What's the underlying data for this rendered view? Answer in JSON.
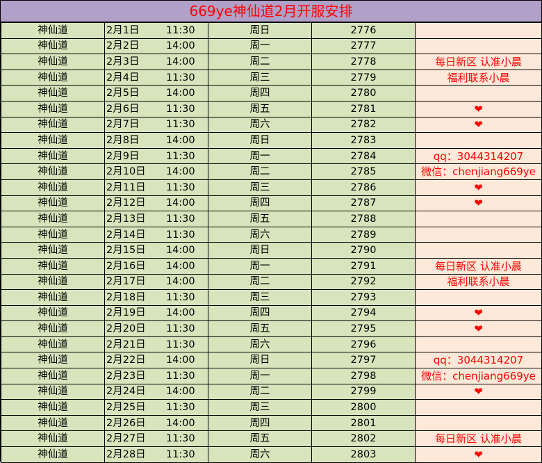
{
  "title": "669ye神仙道2月开服安排",
  "colors": {
    "header_bg": "#b1a0c7",
    "title_text": "#ff0000",
    "data_cell_bg": "#d8e4bc",
    "note_cell_bg": "#fde9d9",
    "note_text": "#ff0000"
  },
  "rows": [
    {
      "game": "神仙道",
      "date": "2月1日",
      "time": "11:30",
      "weekday": "周日",
      "server": "2776",
      "note": ""
    },
    {
      "game": "神仙道",
      "date": "2月2日",
      "time": "14:00",
      "weekday": "周一",
      "server": "2777",
      "note": ""
    },
    {
      "game": "神仙道",
      "date": "2月3日",
      "time": "14:00",
      "weekday": "周二",
      "server": "2778",
      "note": "每日新区 认准小晨"
    },
    {
      "game": "神仙道",
      "date": "2月4日",
      "time": "11:30",
      "weekday": "周三",
      "server": "2779",
      "note": "福利联系小晨"
    },
    {
      "game": "神仙道",
      "date": "2月5日",
      "time": "14:00",
      "weekday": "周四",
      "server": "2780",
      "note": ""
    },
    {
      "game": "神仙道",
      "date": "2月6日",
      "time": "11:30",
      "weekday": "周五",
      "server": "2781",
      "note": "❤"
    },
    {
      "game": "神仙道",
      "date": "2月7日",
      "time": "11:30",
      "weekday": "周六",
      "server": "2782",
      "note": "❤"
    },
    {
      "game": "神仙道",
      "date": "2月8日",
      "time": "14:00",
      "weekday": "周日",
      "server": "2783",
      "note": ""
    },
    {
      "game": "神仙道",
      "date": "2月9日",
      "time": "11:30",
      "weekday": "周一",
      "server": "2784",
      "note": "qq：3044314207"
    },
    {
      "game": "神仙道",
      "date": "2月10日",
      "time": "14:00",
      "weekday": "周二",
      "server": "2785",
      "note": "微信：chenjiang669ye"
    },
    {
      "game": "神仙道",
      "date": "2月11日",
      "time": "11:30",
      "weekday": "周三",
      "server": "2786",
      "note": "❤"
    },
    {
      "game": "神仙道",
      "date": "2月12日",
      "time": "14:00",
      "weekday": "周四",
      "server": "2787",
      "note": "❤"
    },
    {
      "game": "神仙道",
      "date": "2月13日",
      "time": "11:30",
      "weekday": "周五",
      "server": "2788",
      "note": ""
    },
    {
      "game": "神仙道",
      "date": "2月14日",
      "time": "11:30",
      "weekday": "周六",
      "server": "2789",
      "note": ""
    },
    {
      "game": "神仙道",
      "date": "2月15日",
      "time": "14:00",
      "weekday": "周日",
      "server": "2790",
      "note": ""
    },
    {
      "game": "神仙道",
      "date": "2月16日",
      "time": "14:00",
      "weekday": "周一",
      "server": "2791",
      "note": "每日新区 认准小晨"
    },
    {
      "game": "神仙道",
      "date": "2月17日",
      "time": "14:00",
      "weekday": "周二",
      "server": "2792",
      "note": "福利联系小晨"
    },
    {
      "game": "神仙道",
      "date": "2月18日",
      "time": "11:30",
      "weekday": "周三",
      "server": "2793",
      "note": ""
    },
    {
      "game": "神仙道",
      "date": "2月19日",
      "time": "14:00",
      "weekday": "周四",
      "server": "2794",
      "note": "❤"
    },
    {
      "game": "神仙道",
      "date": "2月20日",
      "time": "11:30",
      "weekday": "周五",
      "server": "2795",
      "note": "❤"
    },
    {
      "game": "神仙道",
      "date": "2月21日",
      "time": "11:30",
      "weekday": "周六",
      "server": "2796",
      "note": ""
    },
    {
      "game": "神仙道",
      "date": "2月22日",
      "time": "14:00",
      "weekday": "周日",
      "server": "2797",
      "note": "qq：3044314207"
    },
    {
      "game": "神仙道",
      "date": "2月23日",
      "time": "11:30",
      "weekday": "周一",
      "server": "2798",
      "note": "微信：chenjiang669ye"
    },
    {
      "game": "神仙道",
      "date": "2月24日",
      "time": "14:00",
      "weekday": "周二",
      "server": "2799",
      "note": "❤"
    },
    {
      "game": "神仙道",
      "date": "2月25日",
      "time": "11:30",
      "weekday": "周三",
      "server": "2800",
      "note": ""
    },
    {
      "game": "神仙道",
      "date": "2月26日",
      "time": "14:00",
      "weekday": "周四",
      "server": "2801",
      "note": ""
    },
    {
      "game": "神仙道",
      "date": "2月27日",
      "time": "11:30",
      "weekday": "周五",
      "server": "2802",
      "note": "每日新区 认准小晨"
    },
    {
      "game": "神仙道",
      "date": "2月28日",
      "time": "11:30",
      "weekday": "周六",
      "server": "2803",
      "note": "❤"
    }
  ]
}
